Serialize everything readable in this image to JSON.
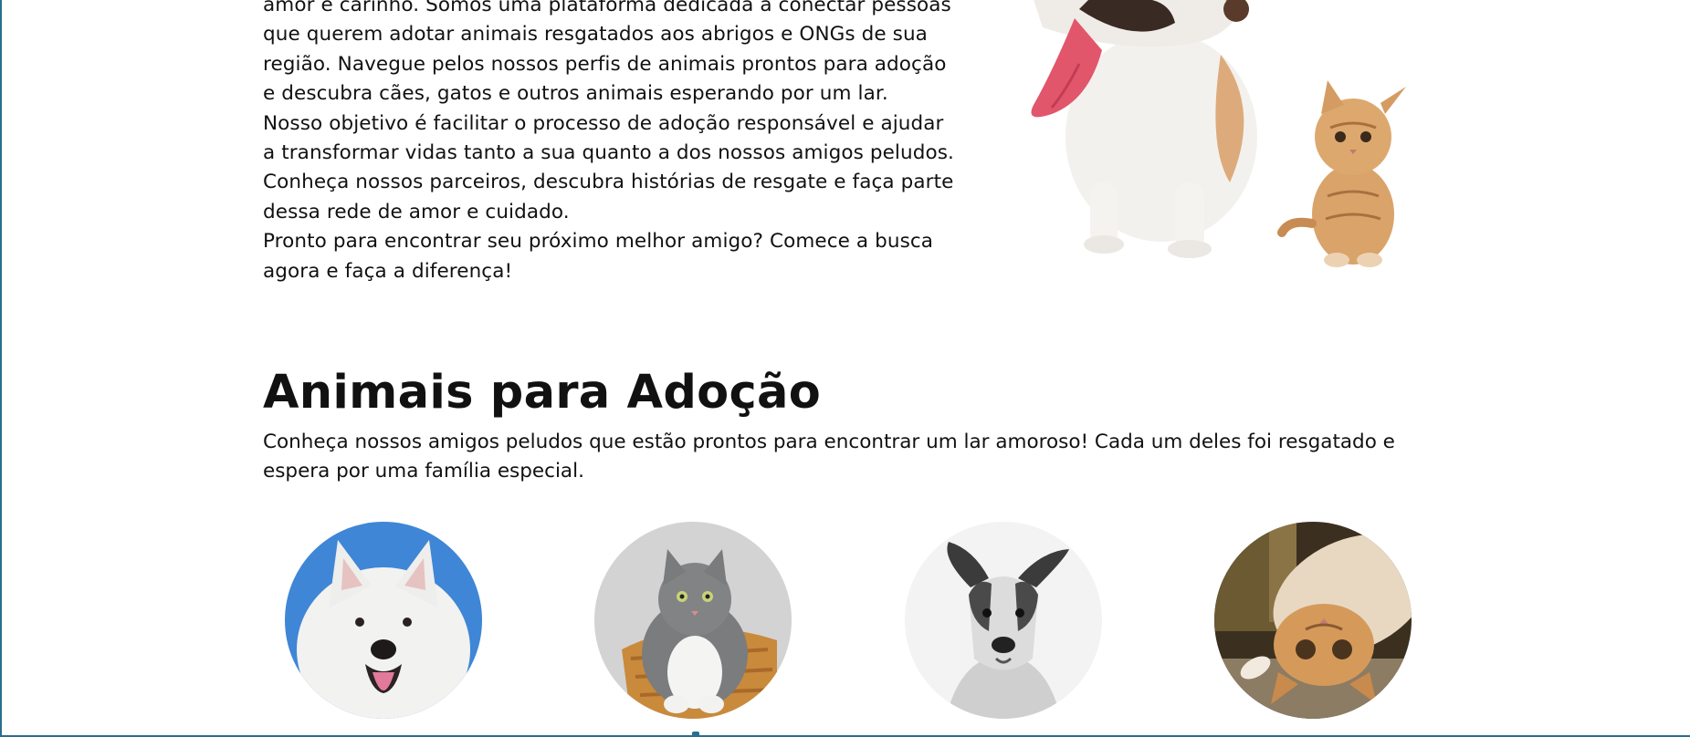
{
  "about": {
    "paragraphs": [
      "amor e carinho. Somos uma plataforma dedicada a conectar pessoas que querem adotar animais resgatados aos abrigos e ONGs de sua região. Navegue pelos nossos perfis de animais prontos para adoção e descubra cães, gatos e outros animais esperando por um lar.",
      "Nosso objetivo é facilitar o processo de adoção responsável e ajudar a transformar vidas tanto a sua quanto a dos nossos amigos peludos. Conheça nossos parceiros, descubra histórias de resgate e faça parte dessa rede de amor e cuidado.",
      "Pronto para encontrar seu próximo melhor amigo? Comece a busca agora e faça a diferença!"
    ]
  },
  "adoption": {
    "title": "Animais para Adoção",
    "description": "Conheça nossos amigos peludos que estão prontos para encontrar um lar amoroso! Cada um deles foi resgatado e espera por uma família especial."
  },
  "colors": {
    "accent": "#2a6f8c",
    "text": "#111111",
    "background": "#ffffff"
  }
}
